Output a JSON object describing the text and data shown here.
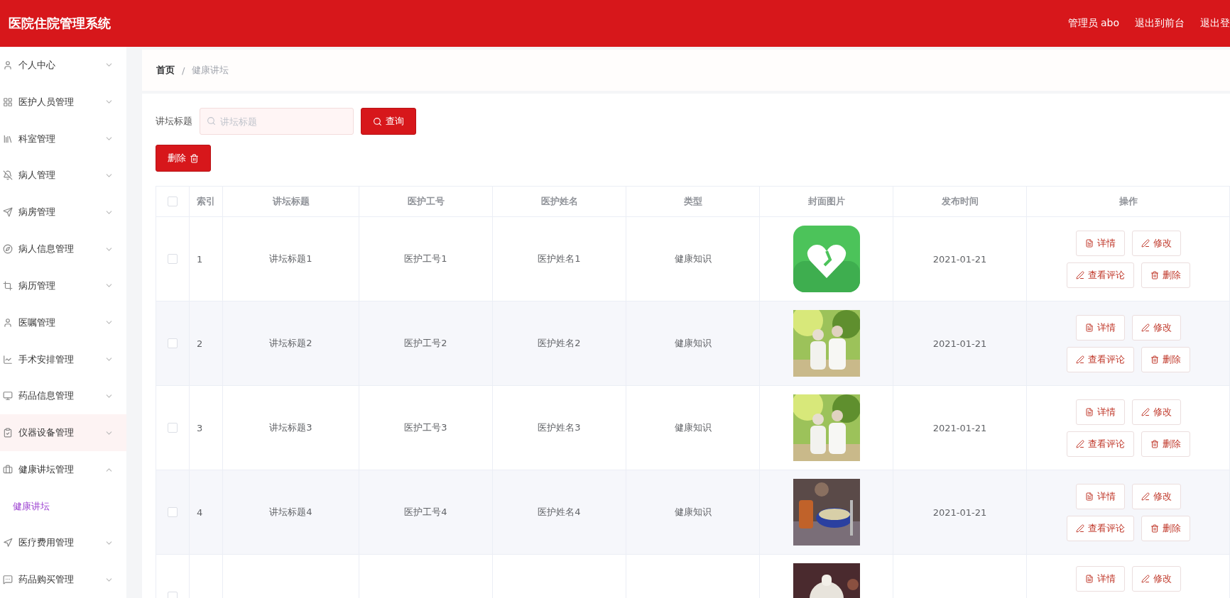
{
  "header": {
    "title": "医院住院管理系统",
    "links": [
      "管理员 abo",
      "退出到前台",
      "退出登"
    ]
  },
  "sidebar": {
    "items": [
      {
        "label": "个人中心",
        "expanded": false,
        "hovered": false
      },
      {
        "label": "医护人员管理",
        "expanded": false,
        "hovered": false
      },
      {
        "label": "科室管理",
        "expanded": false,
        "hovered": false
      },
      {
        "label": "病人管理",
        "expanded": false,
        "hovered": false
      },
      {
        "label": "病房管理",
        "expanded": false,
        "hovered": false
      },
      {
        "label": "病人信息管理",
        "expanded": false,
        "hovered": false
      },
      {
        "label": "病历管理",
        "expanded": false,
        "hovered": false
      },
      {
        "label": "医嘱管理",
        "expanded": false,
        "hovered": false
      },
      {
        "label": "手术安排管理",
        "expanded": false,
        "hovered": false
      },
      {
        "label": "药品信息管理",
        "expanded": false,
        "hovered": false
      },
      {
        "label": "仪器设备管理",
        "expanded": false,
        "hovered": true
      },
      {
        "label": "健康讲坛管理",
        "expanded": true,
        "hovered": false,
        "children": [
          {
            "label": "健康讲坛",
            "selected": true
          }
        ]
      },
      {
        "label": "医疗费用管理",
        "expanded": false,
        "hovered": false
      },
      {
        "label": "药品购买管理",
        "expanded": false,
        "hovered": false
      }
    ]
  },
  "breadcrumb": [
    "首页",
    "/",
    "健康讲坛"
  ],
  "search": {
    "label": "讲坛标题",
    "placeholder": "讲坛标题",
    "button": "查询"
  },
  "delete_button": "删除",
  "table": {
    "header_checked": false,
    "columns": [
      "索引",
      "讲坛标题",
      "医护工号",
      "医护姓名",
      "类型",
      "封面图片",
      "发布时间",
      "操作"
    ],
    "rows": [
      {
        "checked": false,
        "index": "1",
        "title": "讲坛标题1",
        "staff_no": "医护工号1",
        "staff_name": "医护姓名1",
        "type": "健康知识",
        "cover": {
          "kind": "picture"
        },
        "date": "2021-01-21",
        "actions": [
          "详情",
          "修改",
          "查看评论",
          "删除"
        ]
      },
      {
        "checked": false,
        "index": "2",
        "title": "讲坛标题2",
        "staff_no": "医护工号2",
        "staff_name": "医护姓名2",
        "type": "健康知识",
        "cover": {
          "kind": "picture"
        },
        "date": "2021-01-21",
        "actions": [
          "详情",
          "修改",
          "查看评论",
          "删除"
        ]
      },
      {
        "checked": false,
        "index": "3",
        "title": "讲坛标题3",
        "staff_no": "医护工号3",
        "staff_name": "医护姓名3",
        "type": "健康知识",
        "cover": {
          "kind": "picture"
        },
        "date": "2021-01-21",
        "actions": [
          "详情",
          "修改",
          "查看评论",
          "删除"
        ]
      },
      {
        "checked": false,
        "index": "4",
        "title": "讲坛标题4",
        "staff_no": "医护工号4",
        "staff_name": "医护姓名4",
        "type": "健康知识",
        "cover": {
          "kind": "picture"
        },
        "date": "2021-01-21",
        "actions": [
          "详情",
          "修改",
          "查看评论",
          "删除"
        ]
      },
      {
        "checked": false,
        "cover": {
          "kind": "picture"
        },
        "actions": [
          "详情",
          "修改"
        ]
      }
    ]
  }
}
